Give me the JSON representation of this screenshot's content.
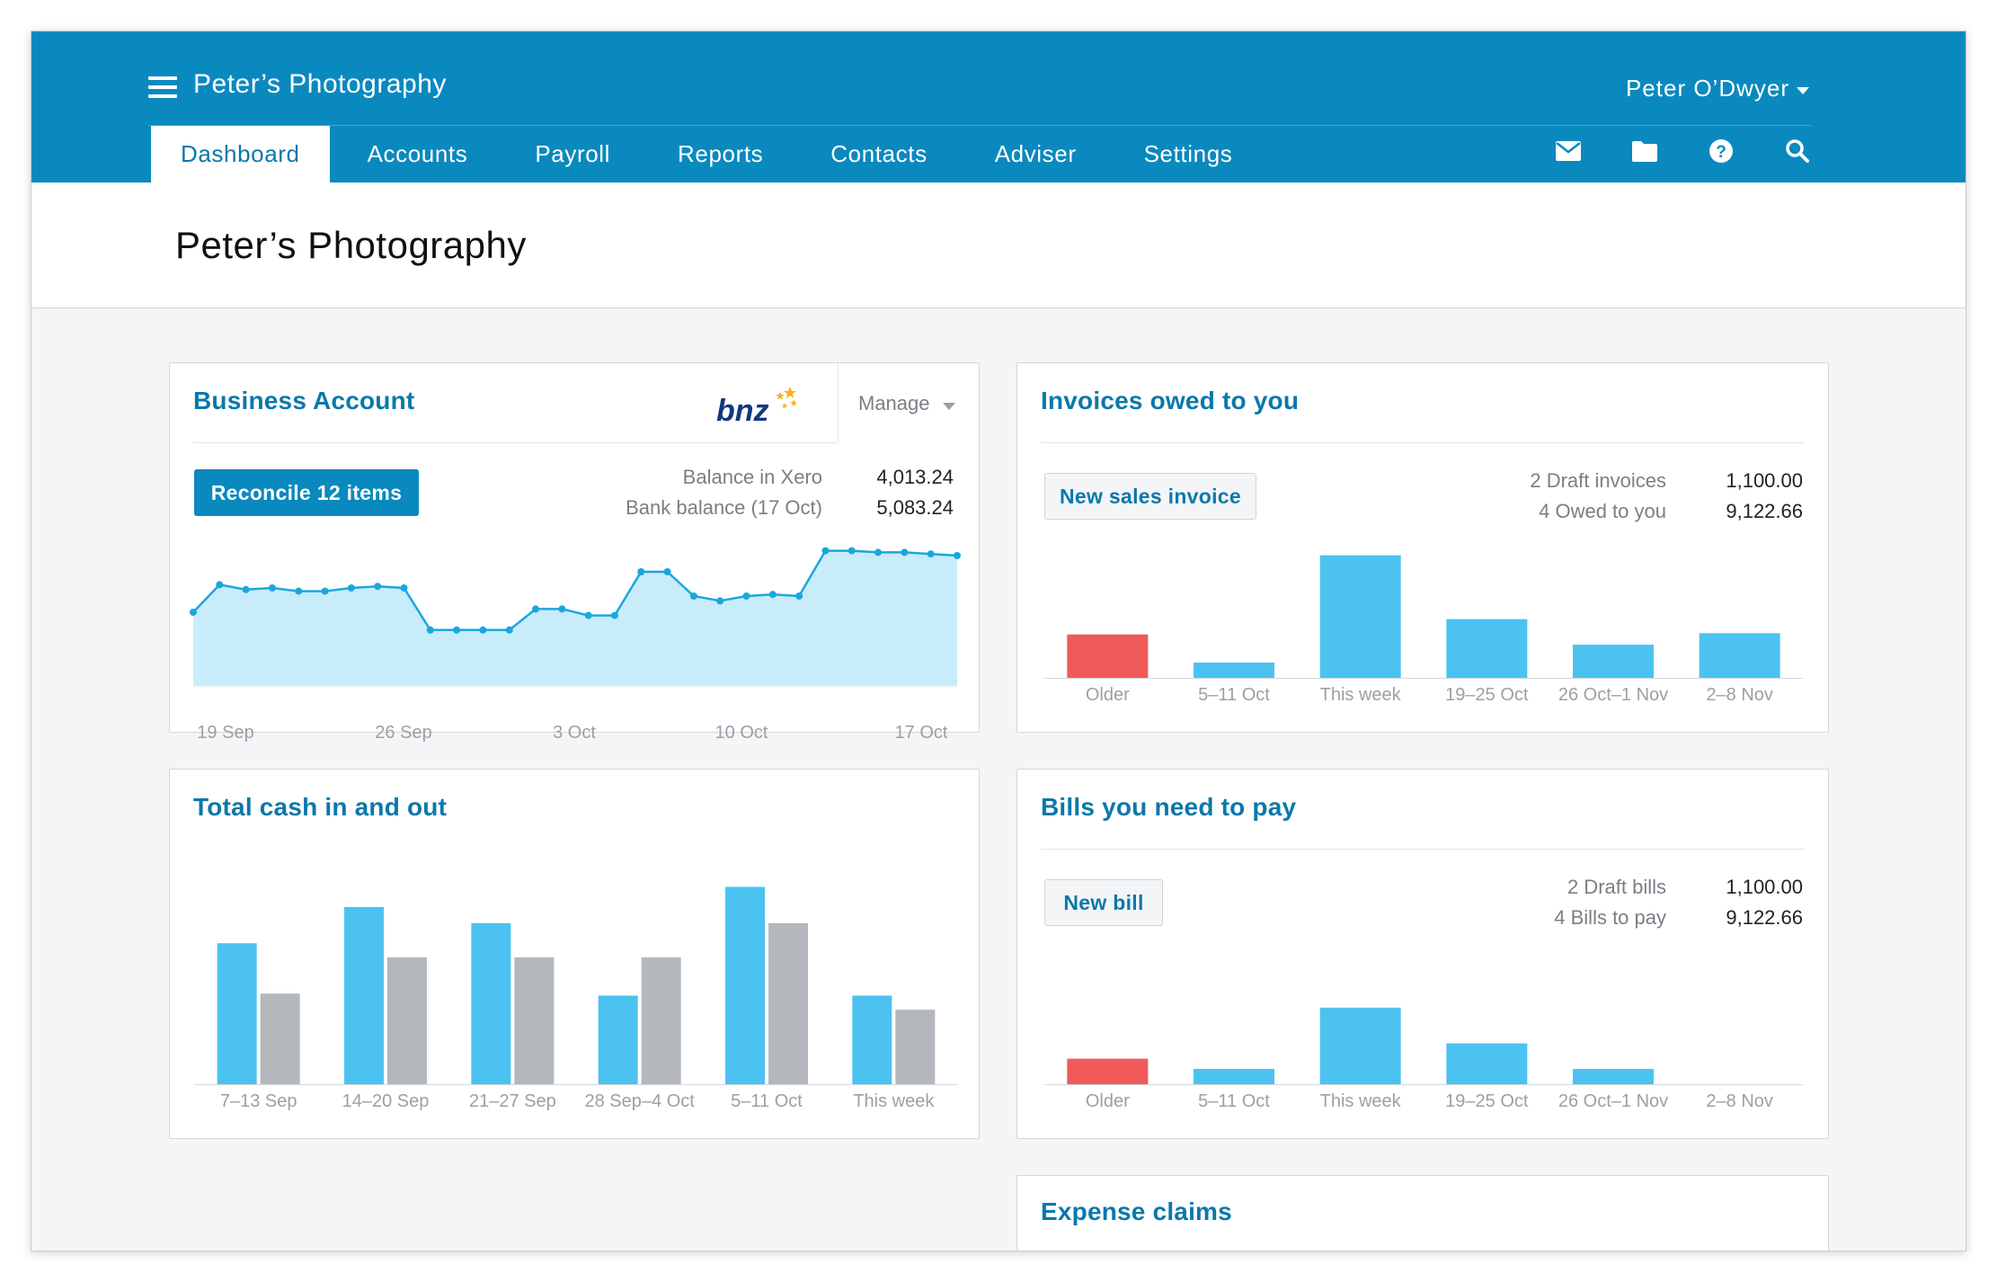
{
  "app": {
    "org_name": "Peter’s Photography",
    "user_name": "Peter O’Dwyer",
    "tabs": [
      {
        "label": "Dashboard",
        "active": true
      },
      {
        "label": "Accounts",
        "active": false
      },
      {
        "label": "Payroll",
        "active": false
      },
      {
        "label": "Reports",
        "active": false
      },
      {
        "label": "Contacts",
        "active": false
      },
      {
        "label": "Adviser",
        "active": false
      },
      {
        "label": "Settings",
        "active": false
      }
    ],
    "util_icons": [
      "mail-icon",
      "folder-icon",
      "help-icon",
      "search-icon"
    ]
  },
  "page": {
    "title": "Peter’s Photography"
  },
  "colors": {
    "brand": "#0a89bf",
    "bar_blue": "#4cc2f1",
    "bar_red": "#f05a5a",
    "bar_grey": "#b4b8bc",
    "area_fill": "#c9ecfa",
    "line": "#1aa7de"
  },
  "business_account": {
    "title": "Business Account",
    "bank_logo": "bnz",
    "manage_label": "Manage",
    "reconcile_label": "Reconcile 12 items",
    "balance_xero_label": "Balance in Xero",
    "balance_xero_value": "4,013.24",
    "bank_balance_label": "Bank balance (17 Oct)",
    "bank_balance_value": "5,083.24"
  },
  "invoices": {
    "title": "Invoices owed to you",
    "button_label": "New sales invoice",
    "draft_label": "2 Draft invoices",
    "draft_value": "1,100.00",
    "owed_label": "4 Owed to you",
    "owed_value": "9,122.66"
  },
  "cash": {
    "title": "Total cash in and out"
  },
  "bills": {
    "title": "Bills you need to pay",
    "button_label": "New bill",
    "draft_label": "2 Draft bills",
    "draft_value": "1,100.00",
    "topay_label": "4 Bills to pay",
    "topay_value": "9,122.66"
  },
  "expense": {
    "title": "Expense claims"
  },
  "chart_data": [
    {
      "id": "balance",
      "type": "area",
      "ticks": [
        "19 Sep",
        "26 Sep",
        "3 Oct",
        "10 Oct",
        "17 Oct"
      ],
      "values": [
        45,
        62,
        59,
        60,
        58,
        58,
        60,
        61,
        60,
        34,
        34,
        34,
        34,
        47,
        47,
        43,
        43,
        70,
        70,
        55,
        52,
        55,
        56,
        55,
        83,
        83,
        82,
        82,
        81,
        80
      ],
      "ylim": [
        0,
        100
      ]
    },
    {
      "id": "invoices",
      "type": "bar",
      "categories": [
        "Older",
        "5–11 Oct",
        "This week",
        "19–25 Oct",
        "26 Oct–1 Nov",
        "2–8 Nov"
      ],
      "values": [
        34,
        12,
        96,
        46,
        26,
        35
      ],
      "highlight": [
        0
      ],
      "ylim": [
        0,
        100
      ]
    },
    {
      "id": "cash",
      "type": "bar",
      "categories": [
        "7–13 Sep",
        "14–20 Sep",
        "21–27 Sep",
        "28 Sep–4 Oct",
        "5–11 Oct",
        "This week"
      ],
      "series": [
        {
          "values": [
            70,
            88,
            80,
            44,
            98,
            44
          ]
        },
        {
          "values": [
            45,
            63,
            63,
            63,
            80,
            37
          ]
        }
      ],
      "ylim": [
        0,
        100
      ]
    },
    {
      "id": "bills",
      "type": "bar",
      "categories": [
        "Older",
        "5–11 Oct",
        "This week",
        "19–25 Oct",
        "26 Oct–1 Nov",
        "2–8 Nov"
      ],
      "values": [
        20,
        12,
        60,
        32,
        12,
        0
      ],
      "highlight": [
        0
      ],
      "ylim": [
        0,
        100
      ]
    }
  ]
}
